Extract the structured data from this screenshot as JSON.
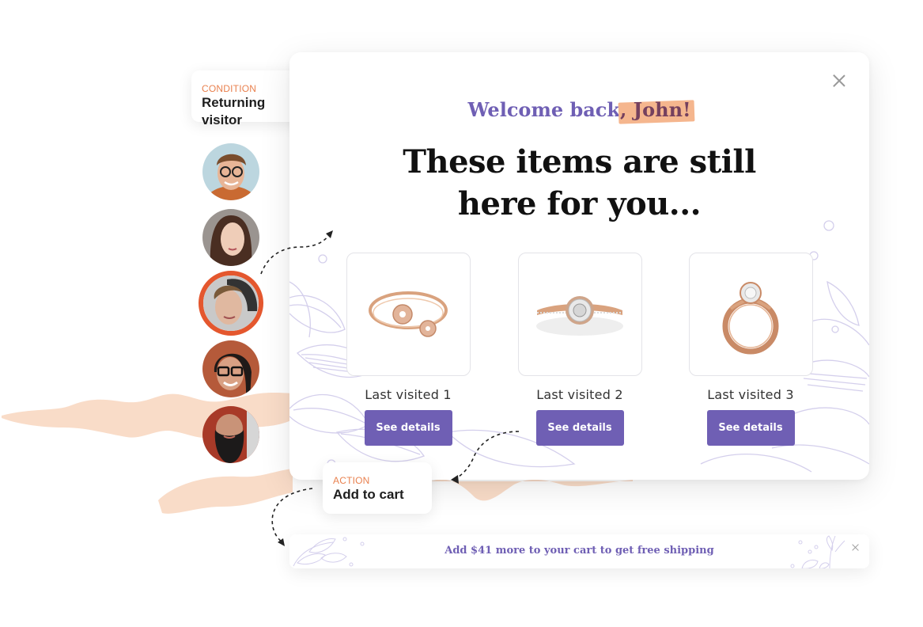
{
  "condition_card": {
    "kicker": "CONDITION",
    "title": "Returning visitor"
  },
  "action_card": {
    "kicker": "ACTION",
    "title": "Add to cart"
  },
  "avatars": [
    {
      "name": "young-man-glasses",
      "selected": false
    },
    {
      "name": "young-woman",
      "selected": false
    },
    {
      "name": "young-man-hat",
      "selected": true
    },
    {
      "name": "woman-glasses",
      "selected": false
    },
    {
      "name": "bearded-man",
      "selected": false
    }
  ],
  "popup": {
    "welcome_prefix": "Welcome back",
    "welcome_name": ", John!",
    "headline_line1": "These items are still",
    "headline_line2": "here for you...",
    "close_icon": "close-icon",
    "products": [
      {
        "label": "Last visited 1",
        "button": "See details",
        "image": "rose-gold-bangle"
      },
      {
        "label": "Last visited 2",
        "button": "See details",
        "image": "halo-diamond-ring"
      },
      {
        "label": "Last visited 3",
        "button": "See details",
        "image": "solitaire-ring"
      }
    ]
  },
  "banner": {
    "text": "Add $41 more to your cart to get free shipping",
    "close_icon": "close-icon"
  },
  "colors": {
    "accent": "#6f5fb4",
    "highlight": "#f5b68e",
    "kicker": "#e9814f",
    "selected_ring": "#e4572e",
    "swoosh": "#f9dcc8"
  }
}
